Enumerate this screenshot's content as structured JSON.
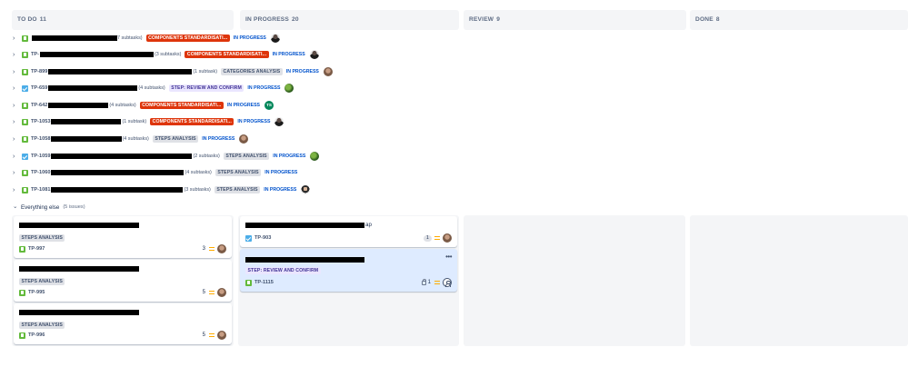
{
  "columns": [
    {
      "name": "TO DO",
      "count": "11"
    },
    {
      "name": "IN PROGRESS",
      "count": "20"
    },
    {
      "name": "REVIEW",
      "count": "9"
    },
    {
      "name": "DONE",
      "count": "8"
    }
  ],
  "parents": [
    {
      "key": "",
      "subtasks": "7 subtasks)",
      "label": "COMPONENTS STANDARDISATI...",
      "status": "IN PROGRESS"
    },
    {
      "key": "TP-",
      "subtasks": "(3 subtasks)",
      "label": "COMPONENTS STANDARDISATI...",
      "status": "IN PROGRESS"
    },
    {
      "key": "TP-899",
      "subtasks": "(1 subtask)",
      "label": "CATEGORIES ANALYSIS",
      "status": "IN PROGRESS"
    },
    {
      "key": "TP-659",
      "subtasks": "(4 subtasks)",
      "label": "STEP: REVIEW AND CONFIRM",
      "status": "IN PROGRESS"
    },
    {
      "key": "TP-642",
      "subtasks": "(4 subtasks)",
      "label": "COMPONENTS STANDARDISATI...",
      "status": "IN PROGRESS",
      "initials": "TS"
    },
    {
      "key": "TP-1053",
      "subtasks": "(1 subtask)",
      "label": "COMPONENTS STANDARDISATI...",
      "status": "IN PROGRESS"
    },
    {
      "key": "TP-1058",
      "subtasks": "(4 subtasks)",
      "label": "STEPS ANALYSIS",
      "status": "IN PROGRESS"
    },
    {
      "key": "TP-1059",
      "subtasks": "(2 subtasks)",
      "label": "STEPS ANALYSIS",
      "status": "IN PROGRESS"
    },
    {
      "key": "TP-1060",
      "subtasks": "(4 subtasks)",
      "label": "STEPS ANALYSIS",
      "status": "IN PROGRESS"
    },
    {
      "key": "TP-1081",
      "subtasks": "(3 subtasks)",
      "label": "STEPS ANALYSIS",
      "status": "IN PROGRESS"
    }
  ],
  "group": {
    "label": "Everything else",
    "count": "(5 issues)"
  },
  "todo_cards": [
    {
      "label": "STEPS ANALYSIS",
      "key": "TP-997",
      "estimate": "3"
    },
    {
      "label": "STEPS ANALYSIS",
      "key": "TP-995",
      "estimate": "5"
    },
    {
      "label": "STEPS ANALYSIS",
      "key": "TP-996",
      "estimate": "5"
    }
  ],
  "inprogress_cards": [
    {
      "title_tail": "ap",
      "key": "TP-903",
      "estimate": "1"
    },
    {
      "label": "STEP: REVIEW AND CONFIRM",
      "key": "TP-1115",
      "count": "1",
      "more": "•••"
    }
  ],
  "colors": {
    "red_lozenge": "#de350b",
    "status_blue": "#0052cc",
    "priority_medium": "#ffab00",
    "story_green": "#63ba3c",
    "task_blue": "#4bade8"
  }
}
